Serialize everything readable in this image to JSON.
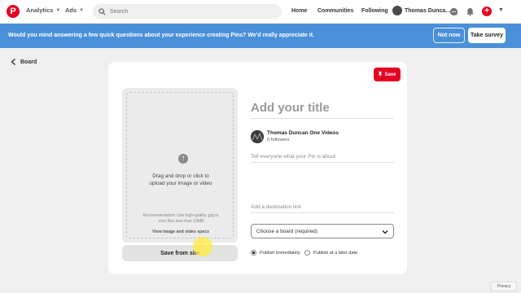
{
  "nav": {
    "logo": "P",
    "analytics": "Analytics",
    "ads": "Ads",
    "search_placeholder": "Search",
    "home": "Home",
    "communities": "Communities",
    "following": "Following",
    "user_name": "Thomas Dunca..."
  },
  "banner": {
    "message": "Would you mind answering a few quick questions about your experience creating Pins? We'd really appreciate it.",
    "not_now": "Not now",
    "take_survey": "Take survey"
  },
  "back": {
    "label": "Board"
  },
  "card": {
    "save_label": "Save",
    "upload_text": "Drag and drop or click to\nupload your image or video",
    "upload_recommendation": "Recommendation: Use high-quality .jpg or\n.mov files less than 10MB",
    "upload_specs": "View image and video specs",
    "save_from_site": "Save from site",
    "title_placeholder": "Add your title",
    "owner_name": "Thomas Duncan One Videos",
    "owner_followers": "0 followers",
    "description_placeholder": "Tell everyone what your Pin is about",
    "link_placeholder": "Add a destination link",
    "board_select": "Choose a board (required)",
    "publish_now": "Publish immediately",
    "publish_later": "Publish at a later date"
  },
  "footer": {
    "privacy": "Privacy"
  },
  "colors": {
    "brand": "#e60023",
    "banner": "#4a90d9"
  }
}
